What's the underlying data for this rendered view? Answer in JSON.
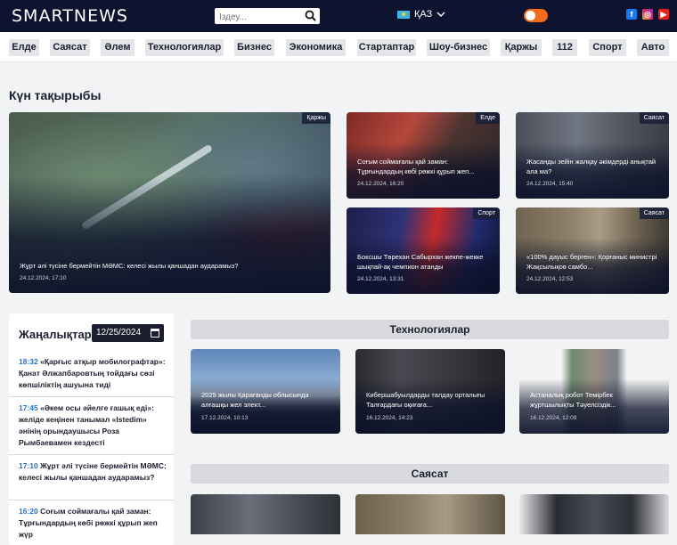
{
  "header": {
    "logo": "SMARTNEWS",
    "search_placeholder": "Іздеу...",
    "language": "ҚАЗ"
  },
  "categories": [
    "Елде",
    "Саясат",
    "Әлем",
    "Технологиялар",
    "Бизнес",
    "Экономика",
    "Стартаптар",
    "Шоу-бизнес",
    "Қаржы",
    "112",
    "Спорт",
    "Авто"
  ],
  "day_topics": {
    "title": "Күн тақырыбы",
    "main": {
      "tag": "Қаржы",
      "title": "Жұрт әлі түсіне бермейтін МӘМС: келесі жылы қаншадан аударамыз?",
      "date": "24.12.2024, 17:10"
    },
    "cards": [
      {
        "tag": "Елде",
        "title": "Соғым соймағалы қай заман: Тұрғындардың көбі рөжкі құрып жеп...",
        "date": "24.12.2024, 16:20"
      },
      {
        "tag": "Саясат",
        "title": "Жасанды зейін жалқау әкімдерді анықтай ала ма?",
        "date": "24.12.2024, 15:40"
      },
      {
        "tag": "Спорт",
        "title": "Боксшы Төрехан Сабырхан жекпе-жекке шықпай-ақ чемпион атанды",
        "date": "24.12.2024, 13:31"
      },
      {
        "tag": "Саясат",
        "title": "«100% дауыс берген»: Қорғаныс министрі Жақсылықов самбо...",
        "date": "24.12.2024, 12:53"
      }
    ]
  },
  "news": {
    "title": "Жаңалықтар",
    "date_value": "12/25/2024",
    "items": [
      {
        "time": "18:32",
        "text": "«Қарғыс атқыр мобилографтар»: Қанат Әлжапбаровтың тойдағы сөзі көпшіліктің ашуына тиді"
      },
      {
        "time": "17:45",
        "text": "«Әкем осы әйелге ғашық еді»: желіде кеңінен танымал «Istedim» әнінің орындаушысы Роза Рымбаевамен кездесті"
      },
      {
        "time": "17:10",
        "text": "Жұрт әлі түсіне бермейтін МӘМС: келесі жылы қаншадан аударамыз?"
      },
      {
        "time": "16:20",
        "text": "Соғым соймағалы қай заман: Тұрғындардың көбі рөжкі құрып жеп жүр"
      }
    ]
  },
  "tech": {
    "title": "Технологиялар",
    "cards": [
      {
        "title": "2025 жылы Қарағанды облысында алғашқы жел элект...",
        "date": "17.12.2024, 10:13"
      },
      {
        "title": "Кибершабуылдарды талдау орталығы Талғардағы оқиғаға...",
        "date": "16.12.2024, 14:23"
      },
      {
        "title": "Астаналық робот Темірбек жұртшылықты Тәуелсіздік...",
        "date": "16.12.2024, 12:09"
      }
    ]
  },
  "politics": {
    "title": "Саясат"
  },
  "colors": {
    "header_bg": "#0e1430",
    "accent": "#f26a1b",
    "time_link": "#1f73c8",
    "chip_bg": "#e4e5e9"
  }
}
